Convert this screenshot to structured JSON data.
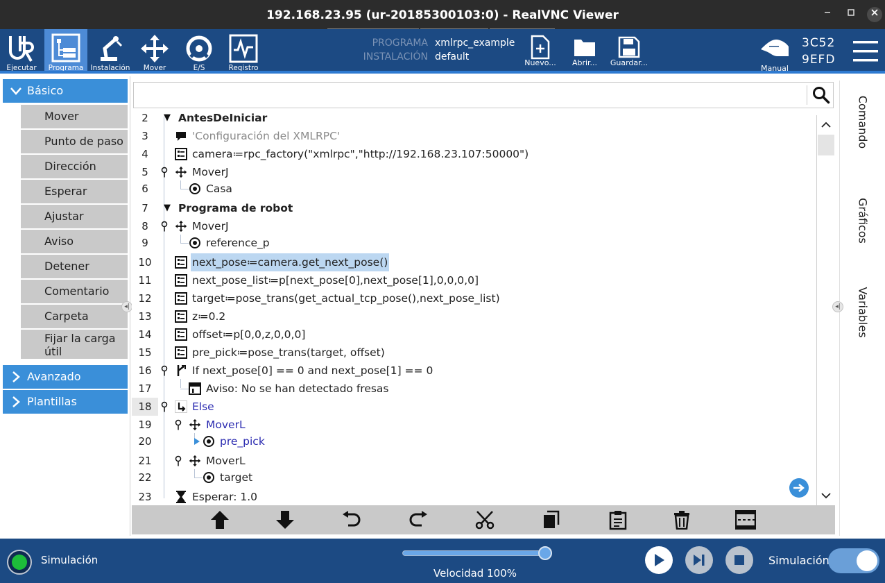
{
  "window": {
    "title": "192.168.23.95 (ur-20185300103:0) - RealVNC Viewer",
    "minimize_icon": "minimize-icon",
    "maximize_icon": "maximize-icon",
    "close_icon": "close-icon"
  },
  "header": {
    "nav": [
      {
        "label": "Ejecutar",
        "icon": "ur-logo-icon",
        "active": false
      },
      {
        "label": "Programa",
        "icon": "program-icon",
        "active": true
      },
      {
        "label": "Instalación",
        "icon": "robot-arm-icon",
        "active": false
      },
      {
        "label": "Mover",
        "icon": "move-arrows-icon",
        "active": false
      },
      {
        "label": "E/S",
        "icon": "io-icon",
        "active": false
      },
      {
        "label": "Registro",
        "icon": "log-icon",
        "active": false
      }
    ],
    "program_label": "PROGRAMA",
    "program_value": "xmlrpc_example",
    "installation_label": "INSTALACIÓN",
    "installation_value": "default",
    "file_buttons": [
      {
        "label": "Nuevo...",
        "icon": "new-file-icon"
      },
      {
        "label": "Abrir...",
        "icon": "folder-icon"
      },
      {
        "label": "Guardar...",
        "icon": "save-icon"
      }
    ],
    "mode_label": "Manual",
    "robot_id_line1": "3C52",
    "robot_id_line2": "9EFD"
  },
  "sidebar": {
    "basic_label": "Básico",
    "basic_items": [
      "Mover",
      "Punto de paso",
      "Dirección",
      "Esperar",
      "Ajustar",
      "Aviso",
      "Detener",
      "Comentario",
      "Carpeta",
      "Fijar la carga útil"
    ],
    "advanced_label": "Avanzado",
    "templates_label": "Plantillas"
  },
  "search": {
    "placeholder": "",
    "value": ""
  },
  "program_tree": [
    {
      "line": "2",
      "text": "AntesDeIniciar"
    },
    {
      "line": "3",
      "text": "'Configuración del XMLRPC'"
    },
    {
      "line": "4",
      "text": "camera≔rpc_factory(\"xmlrpc\",\"http://192.168.23.107:50000\")"
    },
    {
      "line": "5",
      "text": "MoverJ"
    },
    {
      "line": "6",
      "text": "Casa"
    },
    {
      "line": "7",
      "text": "Programa de robot"
    },
    {
      "line": "8",
      "text": "MoverJ"
    },
    {
      "line": "9",
      "text": "reference_p"
    },
    {
      "line": "10",
      "text": "next_pose≔camera.get_next_pose()"
    },
    {
      "line": "11",
      "text": "next_pose_list≔p[next_pose[0],next_pose[1],0,0,0,0]"
    },
    {
      "line": "12",
      "text": "target≔pose_trans(get_actual_tcp_pose(),next_pose_list)"
    },
    {
      "line": "13",
      "text": "z≔0.2"
    },
    {
      "line": "14",
      "text": "offset≔p[0,0,z,0,0,0]"
    },
    {
      "line": "15",
      "text": "pre_pick≔pose_trans(target, offset)"
    },
    {
      "line": "16",
      "text": "If next_pose[0] == 0 and next_pose[1] == 0"
    },
    {
      "line": "17",
      "text": "Aviso: No se han detectado fresas"
    },
    {
      "line": "18",
      "text": "Else"
    },
    {
      "line": "19",
      "text": "MoverL"
    },
    {
      "line": "20",
      "text": "pre_pick"
    },
    {
      "line": "21",
      "text": "MoverL"
    },
    {
      "line": "22",
      "text": "target"
    },
    {
      "line": "23",
      "text": "Esperar: 1.0"
    }
  ],
  "toolbar": [
    "move-up-icon",
    "move-down-icon",
    "undo-icon",
    "redo-icon",
    "cut-icon",
    "copy-icon",
    "paste-icon",
    "delete-icon",
    "suppress-icon"
  ],
  "right_tabs": [
    "Comando",
    "Gráficos",
    "Variables"
  ],
  "footer": {
    "status_label": "Simulación",
    "speed_text": "Velocidad 100%",
    "speed_fraction": 1.0,
    "sim_toggle_label": "Simulación",
    "sim_toggle_on": true
  },
  "colors": {
    "header_blue": "#1c4a83",
    "accent_blue": "#3a8fd9",
    "status_green": "#1dbd3a",
    "selection": "#bcd7f1"
  }
}
